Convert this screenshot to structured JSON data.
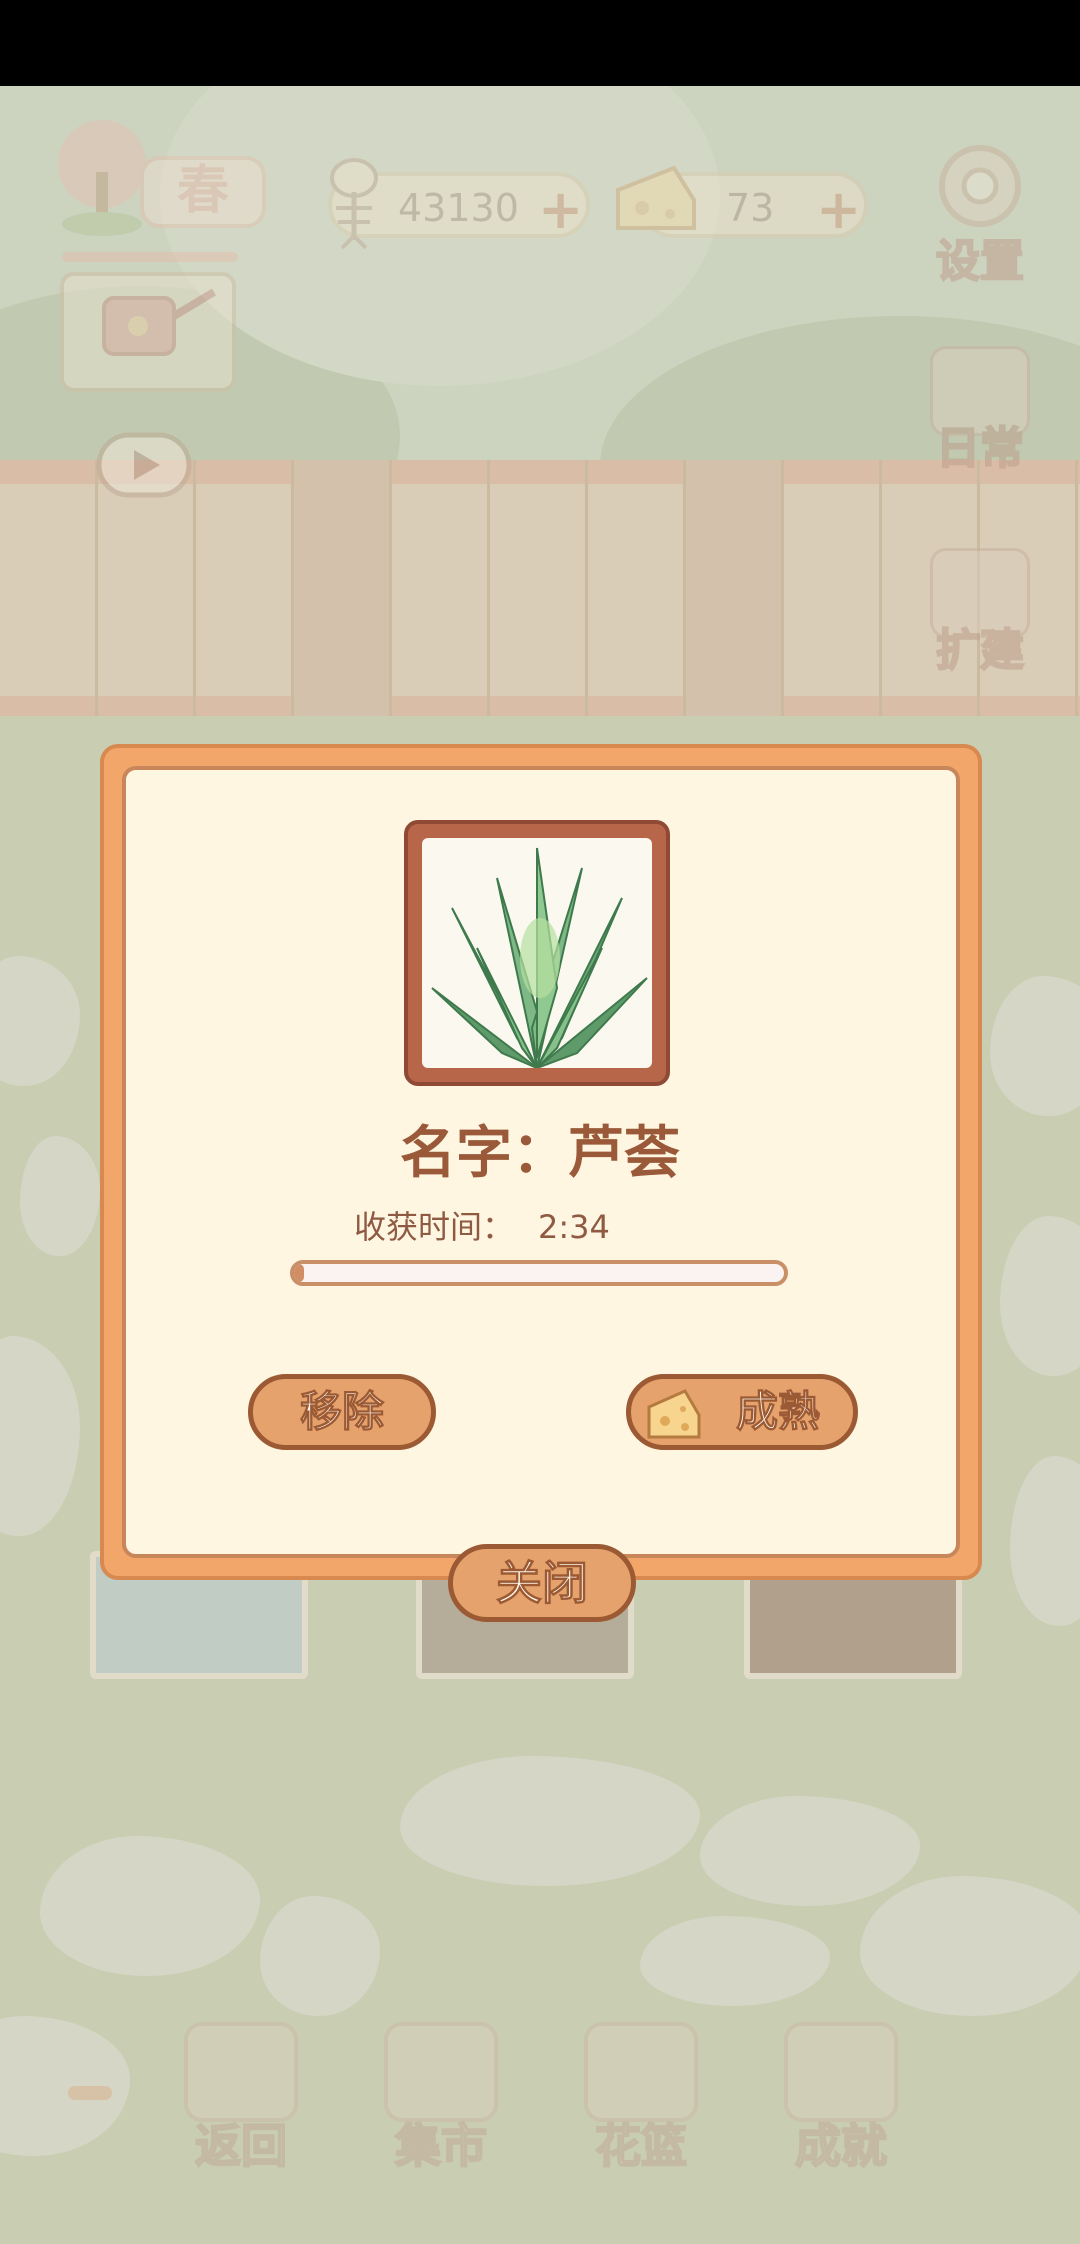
{
  "hud": {
    "season_label": "春",
    "fish_coins": "43130",
    "cheese_count": "73",
    "plus_symbol": "+"
  },
  "side_menu": {
    "settings": "设置",
    "daily": "日常",
    "expand": "扩建"
  },
  "bottom_nav": {
    "back": "返回",
    "market": "集市",
    "flower_basket": "花篮",
    "achievements": "成就"
  },
  "dialog": {
    "name_label": "名字：",
    "plant_name": "芦荟",
    "harvest_time_label": "收获时间：",
    "harvest_time_value": "2:34",
    "progress": 0.02,
    "remove_button": "移除",
    "mature_button": "成熟",
    "close_button": "关闭"
  },
  "colors": {
    "dialog_border": "#f2a66a",
    "dialog_bg": "#fff6e2",
    "button_fill": "#e6a26c",
    "button_stroke": "#9c5a34",
    "title_text": "#9a5a3a"
  },
  "icons": {
    "fish_coin": "fish-bone-icon",
    "cheese": "cheese-icon",
    "settings": "gear-icon",
    "watering": "watering-can-icon",
    "plant": "aloe-icon"
  }
}
